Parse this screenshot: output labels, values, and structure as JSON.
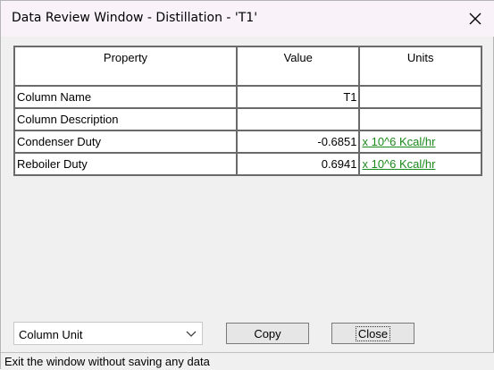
{
  "window": {
    "title": "Data Review Window - Distillation - 'T1'"
  },
  "table": {
    "headers": [
      "Property",
      "Value",
      "Units"
    ],
    "rows": [
      {
        "property": "Column Name",
        "value": "T1",
        "units": ""
      },
      {
        "property": "Column Description",
        "value": "",
        "units": ""
      },
      {
        "property": "Condenser Duty",
        "value": "-0.6851",
        "units": "x 10^6 Kcal/hr"
      },
      {
        "property": "Reboiler Duty",
        "value": "0.6941",
        "units": "x 10^6 Kcal/hr"
      }
    ]
  },
  "controls": {
    "unit_select_value": "Column Unit",
    "copy_label": "Copy",
    "close_label": "Close"
  },
  "status": {
    "text": "Exit the window without saving any data"
  },
  "colors": {
    "link": "#1a8a1a",
    "grid_border": "#6a6a6a",
    "titlebar": "#f9f3f9"
  }
}
